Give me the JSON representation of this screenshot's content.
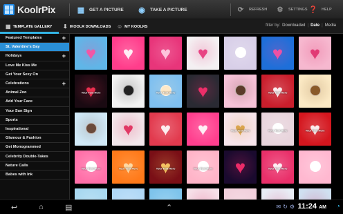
{
  "app": {
    "name": "KoolrPix"
  },
  "actions": {
    "get_picture": "GET A PICTURE",
    "take_picture": "TAKE A PICTURE",
    "refresh": "REFRESH",
    "settings": "SETTINGS",
    "help": "HELP"
  },
  "tabs": {
    "template_gallery": "TEMPLATE GALLERY",
    "ikoolr_downloads": "IKOOLR DOWNLOADS",
    "my_koolrs": "MY KOOLRS"
  },
  "filter": {
    "label": "filter by:",
    "options": [
      "Downloaded",
      "Date",
      "Media"
    ],
    "selected": "Date"
  },
  "sidebar": {
    "items": [
      {
        "label": "Featured Templates",
        "expandable": true,
        "selected": false
      },
      {
        "label": "St. Valentine's Day",
        "expandable": false,
        "selected": true
      },
      {
        "label": "Holidays",
        "expandable": true,
        "selected": false
      },
      {
        "label": "Love Me Kiss Me",
        "expandable": false,
        "selected": false
      },
      {
        "label": "Get Your Sexy On",
        "expandable": false,
        "selected": false
      },
      {
        "label": "Celebrations",
        "expandable": true,
        "selected": false
      },
      {
        "label": "Animal Zoo",
        "expandable": false,
        "selected": false
      },
      {
        "label": "Add Your Face",
        "expandable": false,
        "selected": false
      },
      {
        "label": "Your Sun Sign",
        "expandable": false,
        "selected": false
      },
      {
        "label": "Sports",
        "expandable": false,
        "selected": false
      },
      {
        "label": "Inspirational",
        "expandable": false,
        "selected": false
      },
      {
        "label": "Glamour & Fashion",
        "expandable": false,
        "selected": false
      },
      {
        "label": "Get Monogrammed",
        "expandable": false,
        "selected": false
      },
      {
        "label": "Celebrity Double-Takes",
        "expandable": false,
        "selected": false
      },
      {
        "label": "Nature Calls",
        "expandable": false,
        "selected": false
      },
      {
        "label": "Babes with Ink",
        "expandable": false,
        "selected": false
      }
    ]
  },
  "gallery": {
    "thumbnails": [
      {
        "bg": "#5fb6e8",
        "accent": "#ff4fa0",
        "icon": "heart",
        "caption": ""
      },
      {
        "bg": "#ff3d8b",
        "accent": "#ffffff",
        "icon": "heart",
        "caption": ""
      },
      {
        "bg": "#e8357a",
        "accent": "#ffd1e4",
        "icon": "heart",
        "caption": ""
      },
      {
        "bg": "#f4f0f2",
        "accent": "#e8357a",
        "icon": "heart",
        "caption": ""
      },
      {
        "bg": "#d8cfe8",
        "accent": "#ffffff",
        "icon": "face",
        "caption": ""
      },
      {
        "bg": "#1e6fd9",
        "accent": "#ff4fa0",
        "icon": "heart",
        "caption": ""
      },
      {
        "bg": "#f6b8cf",
        "accent": "#e0306e",
        "icon": "heart",
        "caption": ""
      },
      {
        "bg": "#1a0a12",
        "accent": "#ff3355",
        "icon": "heart",
        "caption": "Your Text Here"
      },
      {
        "bg": "#f2f2f2",
        "accent": "#222222",
        "icon": "face",
        "caption": ""
      },
      {
        "bg": "#7fc0f0",
        "accent": "#ffe9c8",
        "icon": "face",
        "caption": "Your Text Here"
      },
      {
        "bg": "#2a2a33",
        "accent": "#ff2f6e",
        "icon": "heart",
        "caption": ""
      },
      {
        "bg": "#f6c2d8",
        "accent": "#5a3a2a",
        "icon": "face",
        "caption": ""
      },
      {
        "bg": "#c91e2c",
        "accent": "#ffffff",
        "icon": "heart",
        "caption": "Your Text Here"
      },
      {
        "bg": "#fbe9c4",
        "accent": "#8a5a2a",
        "icon": "face",
        "caption": ""
      },
      {
        "bg": "#cfe8f6",
        "accent": "#6a4a3a",
        "icon": "face",
        "caption": ""
      },
      {
        "bg": "#f2e6ea",
        "accent": "#e02a5a",
        "icon": "heart",
        "caption": ""
      },
      {
        "bg": "#e23a4e",
        "accent": "#ffffff",
        "icon": "heart",
        "caption": ""
      },
      {
        "bg": "#ff3f8e",
        "accent": "#ffffff",
        "icon": "heart",
        "caption": ""
      },
      {
        "bg": "#f7e4ea",
        "accent": "#d8a040",
        "icon": "heart",
        "caption": "Your Text Here"
      },
      {
        "bg": "#e8d4dc",
        "accent": "#ffffff",
        "icon": "face",
        "caption": "Your Text Here"
      },
      {
        "bg": "#d4161e",
        "accent": "#ffffff",
        "icon": "heart",
        "caption": "Your Text Here"
      },
      {
        "bg": "#ff6fa8",
        "accent": "#ffffff",
        "icon": "face",
        "caption": "Your Text Here"
      },
      {
        "bg": "#ff7a1a",
        "accent": "#ffe2b0",
        "icon": "heart",
        "caption": "Your Text Here"
      },
      {
        "bg": "#7a0f16",
        "accent": "#ffd36a",
        "icon": "heart",
        "caption": "Your Text Here"
      },
      {
        "bg": "#ffb4c8",
        "accent": "#ffffff",
        "icon": "face",
        "caption": "Your Text Here"
      },
      {
        "bg": "#1a0a2e",
        "accent": "#ff2f6e",
        "icon": "heart",
        "caption": ""
      },
      {
        "bg": "#e9306a",
        "accent": "#ffffff",
        "icon": "heart",
        "caption": "Your Text Here"
      },
      {
        "bg": "#ffb8d0",
        "accent": "#ffffff",
        "icon": "face",
        "caption": ""
      },
      {
        "bg": "#a8d8f0",
        "accent": "#ffffff",
        "icon": "heart",
        "caption": ""
      },
      {
        "bg": "#b0d8f6",
        "accent": "#ffffff",
        "icon": "heart",
        "caption": ""
      },
      {
        "bg": "#7ec4ec",
        "accent": "#ffffff",
        "icon": "heart",
        "caption": ""
      },
      {
        "bg": "#f6e0e8",
        "accent": "#e0306e",
        "icon": "heart",
        "caption": ""
      },
      {
        "bg": "#f2d0dc",
        "accent": "#ffffff",
        "icon": "heart",
        "caption": ""
      },
      {
        "bg": "#e8eef6",
        "accent": "#e0306e",
        "icon": "heart",
        "caption": ""
      },
      {
        "bg": "#cfe0f0",
        "accent": "#e0306e",
        "icon": "heart",
        "caption": ""
      }
    ]
  },
  "system": {
    "time": "11:24",
    "ampm": "AM"
  }
}
